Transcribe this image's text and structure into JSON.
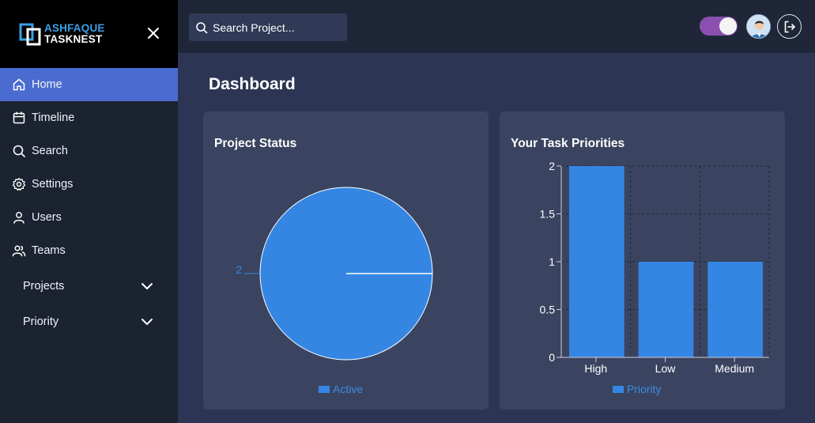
{
  "brand": {
    "line1": "ASHFAQUE",
    "line2": "TASKNEST"
  },
  "search": {
    "placeholder": "Search Project..."
  },
  "sidebar": {
    "items": [
      {
        "label": "Home",
        "icon": "home-icon",
        "active": true
      },
      {
        "label": "Timeline",
        "icon": "calendar-icon",
        "active": false
      },
      {
        "label": "Search",
        "icon": "search-icon",
        "active": false
      },
      {
        "label": "Settings",
        "icon": "gear-icon",
        "active": false
      },
      {
        "label": "Users",
        "icon": "user-icon",
        "active": false
      },
      {
        "label": "Teams",
        "icon": "users-icon",
        "active": false
      }
    ],
    "groups": [
      {
        "label": "Projects",
        "icon": "chevron-down-icon"
      },
      {
        "label": "Priority",
        "icon": "chevron-down-icon"
      }
    ]
  },
  "page": {
    "title": "Dashboard"
  },
  "colors": {
    "active": "#4a6bd0",
    "chart": "#3586e3",
    "accent_toggle": "#8a4fb0"
  },
  "cards": {
    "project_status": {
      "title": "Project Status"
    },
    "task_priorities": {
      "title": "Your Task Priorities"
    }
  },
  "chart_data": [
    {
      "type": "pie",
      "labels": [
        "Active"
      ],
      "values": [
        2
      ],
      "legend": [
        "Active"
      ],
      "legend_position": "bottom"
    },
    {
      "type": "bar",
      "categories": [
        "High",
        "Low",
        "Medium"
      ],
      "series": [
        {
          "name": "Priority",
          "values": [
            2,
            1,
            1
          ]
        }
      ],
      "ylim": [
        0,
        2
      ],
      "yticks": [
        "0",
        "0.5",
        "1",
        "1.5",
        "2"
      ],
      "grid": true,
      "legend_position": "bottom"
    }
  ]
}
